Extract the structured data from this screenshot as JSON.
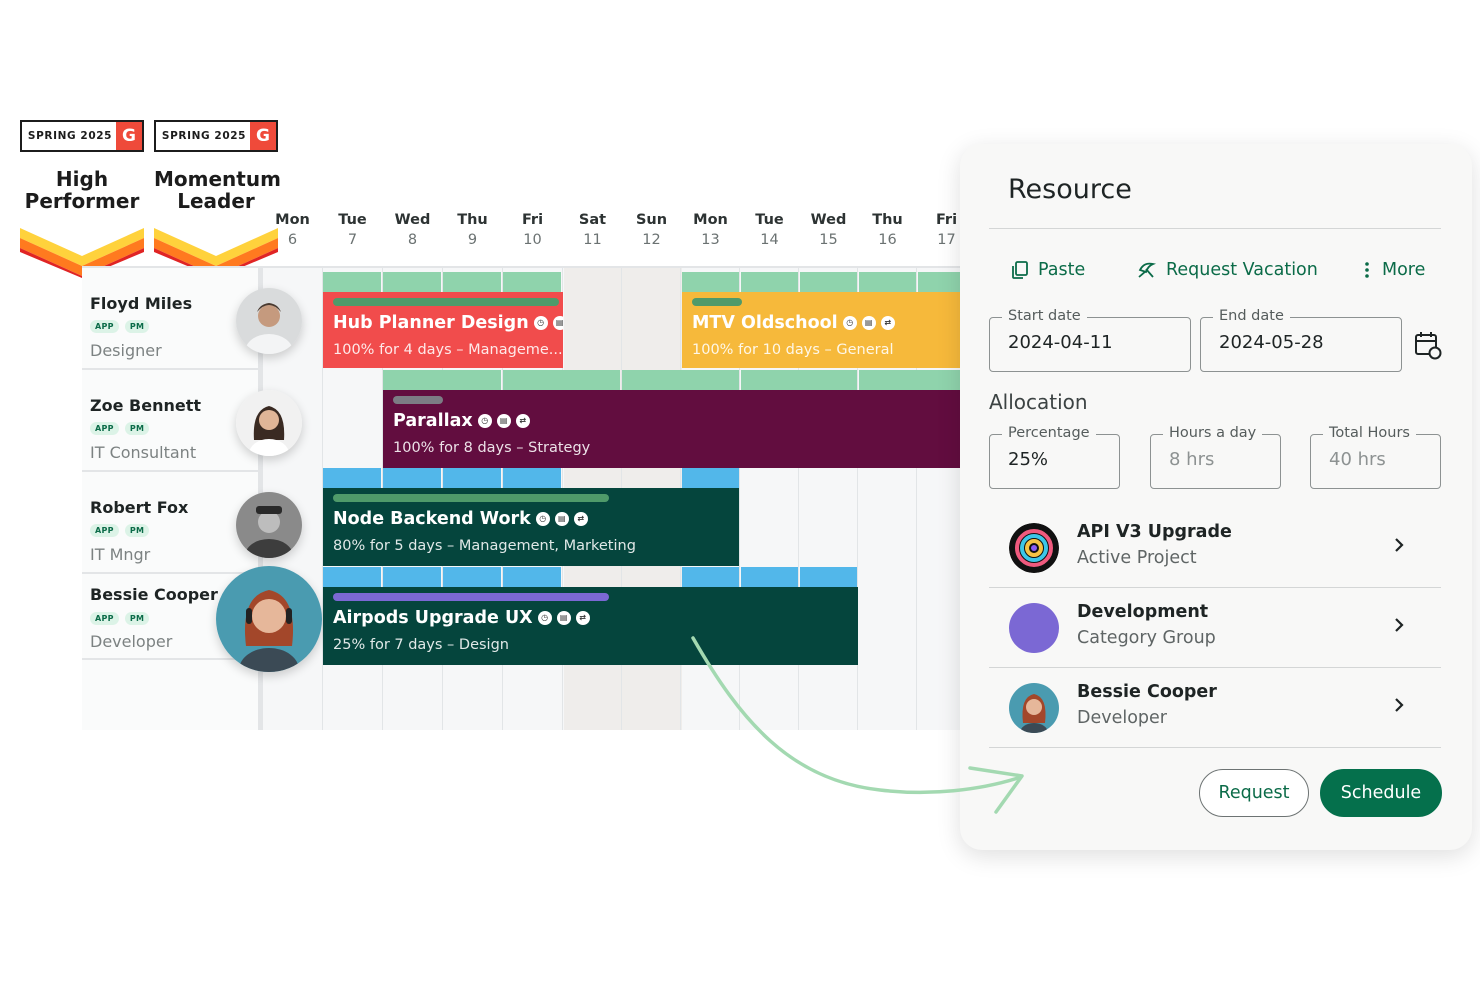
{
  "badges": [
    {
      "season": "SPRING 2025",
      "logo": "G",
      "title_line1": "High",
      "title_line2": "Performer"
    },
    {
      "season": "SPRING 2025",
      "logo": "G",
      "title_line1": "Momentum",
      "title_line2": "Leader"
    }
  ],
  "calendar": {
    "days": [
      {
        "name": "Mon",
        "num": "6"
      },
      {
        "name": "Tue",
        "num": "7"
      },
      {
        "name": "Wed",
        "num": "8"
      },
      {
        "name": "Thu",
        "num": "9"
      },
      {
        "name": "Fri",
        "num": "10"
      },
      {
        "name": "Sat",
        "num": "11"
      },
      {
        "name": "Sun",
        "num": "12"
      },
      {
        "name": "Mon",
        "num": "13"
      },
      {
        "name": "Tue",
        "num": "14"
      },
      {
        "name": "Wed",
        "num": "15"
      },
      {
        "name": "Thu",
        "num": "16"
      },
      {
        "name": "Fri",
        "num": "17"
      }
    ],
    "resources": [
      {
        "name": "Floyd Miles",
        "tags": [
          "APP",
          "PM"
        ],
        "role": "Designer"
      },
      {
        "name": "Zoe Bennett",
        "tags": [
          "APP",
          "PM"
        ],
        "role": "IT Consultant"
      },
      {
        "name": "Robert Fox",
        "tags": [
          "APP",
          "PM"
        ],
        "role": "IT Mngr"
      },
      {
        "name": "Bessie Cooper",
        "tags": [
          "APP",
          "PM"
        ],
        "role": "Developer"
      }
    ],
    "tasks": [
      {
        "title": "Hub Planner Design",
        "subtitle": "100% for 4 days – Manageme...",
        "color": "#f14c4c",
        "bar_color": "#4f9a6a"
      },
      {
        "title": "MTV Oldschool",
        "subtitle": "100% for 10 days – General",
        "color": "#f6b93b",
        "bar_color": "#4f9a6a"
      },
      {
        "title": "Parallax",
        "subtitle": "100% for 8 days – Strategy",
        "color": "#620d3f",
        "bar_color": "#7c7c84"
      },
      {
        "title": "Node Backend Work",
        "subtitle": "80% for 5 days – Management, Marketing",
        "color": "#05453d",
        "bar_color": "#4f9a6a"
      },
      {
        "title": "Airpods Upgrade UX",
        "subtitle": "25% for 7 days – Design",
        "color": "#05453d",
        "bar_color": "#7b68d4"
      }
    ],
    "capacity_colors": {
      "green": "#8fd3ac",
      "blue": "#52b7ea"
    }
  },
  "panel": {
    "title": "Resource",
    "actions": {
      "paste": "Paste",
      "request_vacation": "Request Vacation",
      "more": "More"
    },
    "start_date": {
      "label": "Start date",
      "value": "2024-04-11"
    },
    "end_date": {
      "label": "End date",
      "value": "2024-05-28"
    },
    "allocation_title": "Allocation",
    "percentage": {
      "label": "Percentage",
      "value": "25%"
    },
    "hours_per_day": {
      "label": "Hours a day",
      "value": "8 hrs"
    },
    "total_hours": {
      "label": "Total Hours",
      "value": "40 hrs"
    },
    "items": [
      {
        "title": "API V3 Upgrade",
        "subtitle": "Active Project"
      },
      {
        "title": "Development",
        "subtitle": "Category Group"
      },
      {
        "title": "Bessie Cooper",
        "subtitle": "Developer"
      }
    ],
    "buttons": {
      "request": "Request",
      "schedule": "Schedule"
    },
    "accent": "#05704c"
  }
}
